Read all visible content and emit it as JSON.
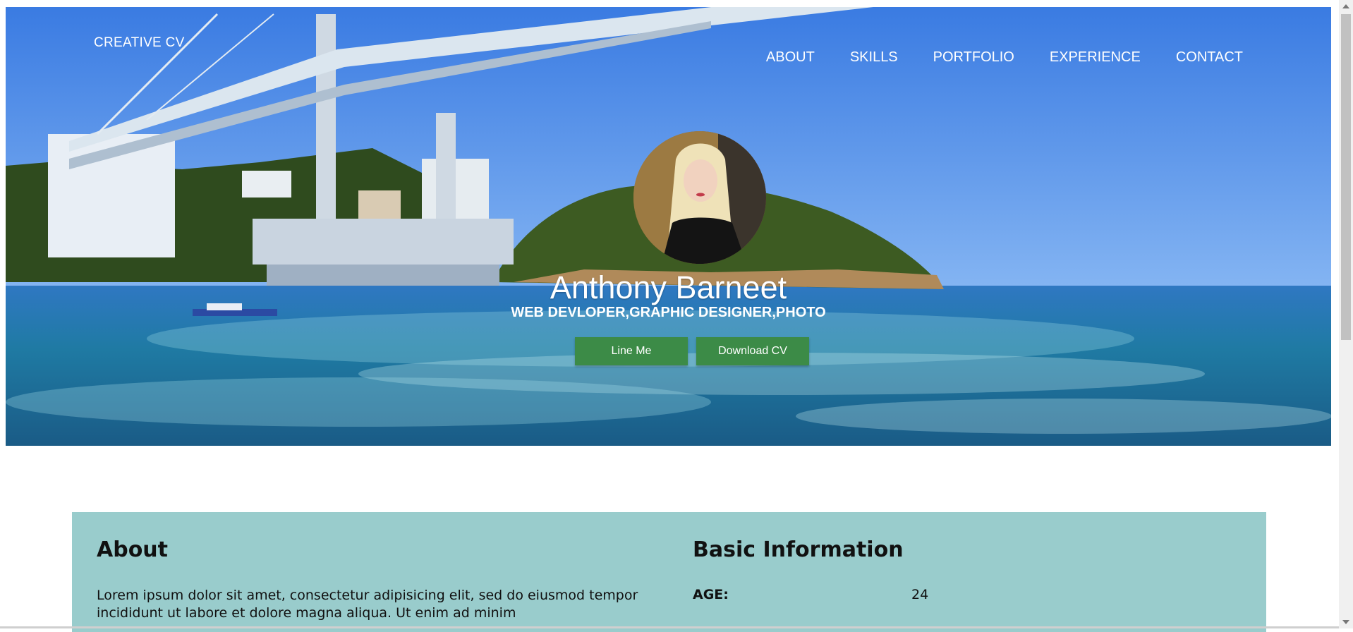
{
  "brand": "CREATIVE CV",
  "nav": {
    "items": [
      {
        "label": "ABOUT"
      },
      {
        "label": "SKILLS"
      },
      {
        "label": "PORTFOLIO"
      },
      {
        "label": "EXPERIENCE"
      },
      {
        "label": "CONTACT"
      }
    ]
  },
  "hero": {
    "name": "Anthony Barneet",
    "title": "WEB DEVLOPER,GRAPHIC DESIGNER,PHOTO",
    "buttons": {
      "line_me": "Line Me",
      "download_cv": "Download CV"
    }
  },
  "about": {
    "heading": "About",
    "text": "Lorem ipsum dolor sit amet, consectetur adipisicing elit, sed do eiusmod tempor incididunt ut labore et dolore magna aliqua. Ut enim ad minim"
  },
  "basic_info": {
    "heading": "Basic Information",
    "rows": [
      {
        "label": "AGE:",
        "value": "24"
      }
    ]
  },
  "colors": {
    "panel": "#99cccc",
    "button": "#3c8b47",
    "sky": "#5c98ef",
    "water": "#1c6592"
  }
}
